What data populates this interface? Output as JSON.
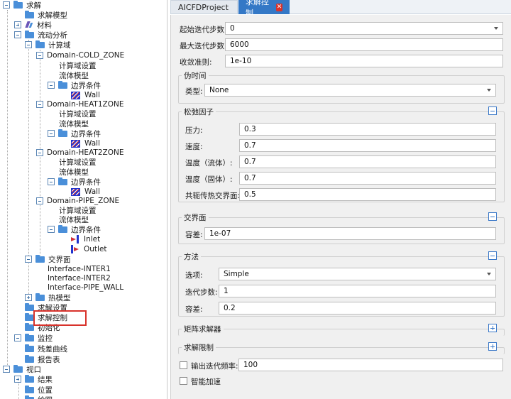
{
  "tree": {
    "root": "求解",
    "solver_model": "求解模型",
    "material": "材料",
    "flow_analysis": "流动分析",
    "domains_folder": "计算域",
    "domain1": "Domain-COLD_ZONE",
    "domain2": "Domain-HEAT1ZONE",
    "domain3": "Domain-HEAT2ZONE",
    "domain4": "Domain-PIPE_ZONE",
    "domain_settings": "计算域设置",
    "fluid_model": "流体模型",
    "boundary_conditions": "边界条件",
    "wall": "Wall",
    "inlet": "Inlet",
    "outlet": "Outlet",
    "interfaces_folder": "交界面",
    "interface1": "Interface-INTER1",
    "interface2": "Interface-INTER2",
    "interface3": "Interface-PIPE_WALL",
    "thermal_model": "热模型",
    "solve_settings": "求解设置",
    "solve_control": "求解控制",
    "initialization": "初始化",
    "monitor": "监控",
    "residual_curve": "残差曲线",
    "report_table": "报告表",
    "view": "视口",
    "results": "结果",
    "position": "位置",
    "drawing": "绘图"
  },
  "tabs": [
    {
      "label": "AICFDProject"
    },
    {
      "label": "求解控制",
      "close": "✕"
    }
  ],
  "form": {
    "start_step_label": "起始迭代步数:",
    "start_step_value": "0",
    "max_step_label": "最大迭代步数:",
    "max_step_value": "6000",
    "convergence_label": "收敛准则:",
    "convergence_value": "1e-10",
    "pseudo_time": {
      "title": "伪时间",
      "type_label": "类型:",
      "type_value": "None"
    },
    "relaxation": {
      "title": "松弛因子",
      "pressure_label": "压力:",
      "pressure_value": "0.3",
      "velocity_label": "速度:",
      "velocity_value": "0.7",
      "temp_fluid_label": "温度（流体）:",
      "temp_fluid_value": "0.7",
      "temp_solid_label": "温度（固体）:",
      "temp_solid_value": "0.7",
      "cht_interface_label": "共轭传热交界面:",
      "cht_interface_value": "0.5"
    },
    "interface": {
      "title": "交界面",
      "tolerance_label": "容差:",
      "tolerance_value": "1e-07"
    },
    "method": {
      "title": "方法",
      "option_label": "选项:",
      "option_value": "Simple",
      "iter_label": "迭代步数:",
      "iter_value": "1",
      "tolerance_label": "容差:",
      "tolerance_value": "0.2"
    },
    "matrix_solver_title": "矩阵求解器",
    "solve_limit_title": "求解限制",
    "output_freq_label": "输出迭代频率:",
    "output_freq_value": "100",
    "smart_accel_label": "智能加速"
  },
  "colors": {
    "tab_active": "#3478c6",
    "folder": "#4a8fd9",
    "highlight": "#d8322b",
    "panel_bg": "#f0f0f0"
  }
}
